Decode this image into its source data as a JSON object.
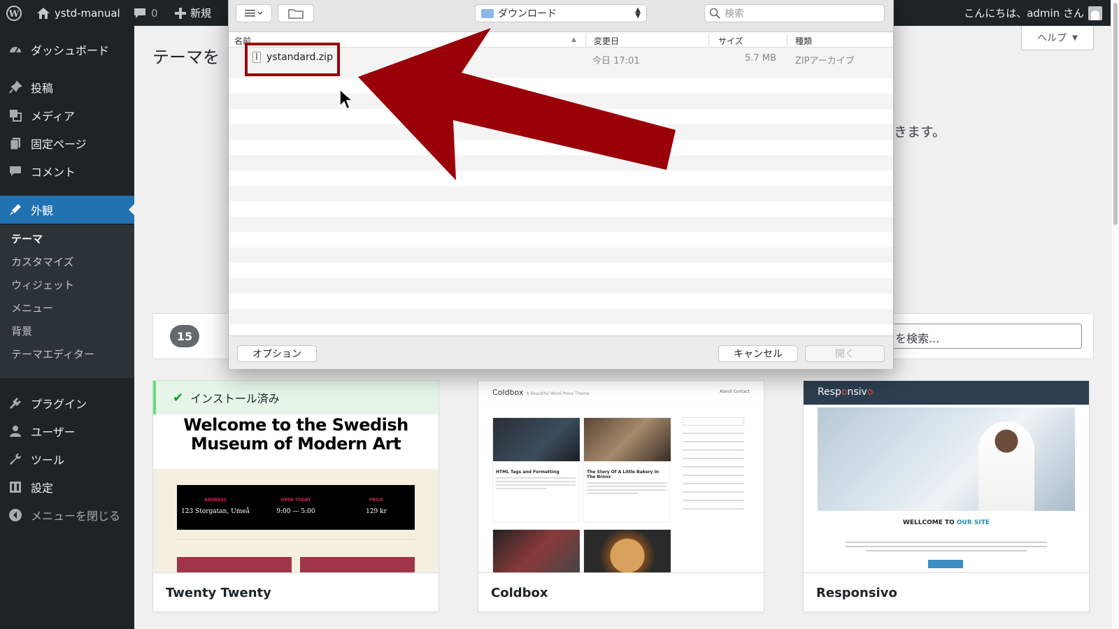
{
  "adminbar": {
    "site_name": "ystd-manual",
    "comment_count": "0",
    "new_label": "新規",
    "greeting": "こんにちは、admin さん"
  },
  "sidebar": {
    "items": [
      {
        "label": "ダッシュボード",
        "icon": "dashboard-icon"
      },
      {
        "label": "投稿",
        "icon": "pin-icon"
      },
      {
        "label": "メディア",
        "icon": "media-icon"
      },
      {
        "label": "固定ページ",
        "icon": "page-icon"
      },
      {
        "label": "コメント",
        "icon": "comment-icon"
      },
      {
        "label": "外観",
        "icon": "appearance-icon"
      },
      {
        "label": "プラグイン",
        "icon": "plugin-icon"
      },
      {
        "label": "ユーザー",
        "icon": "user-icon"
      },
      {
        "label": "ツール",
        "icon": "wrench-icon"
      },
      {
        "label": "設定",
        "icon": "settings-icon"
      }
    ],
    "submenu": [
      "テーマ",
      "カスタマイズ",
      "ウィジェット",
      "メニュー",
      "背景",
      "テーマエディター"
    ],
    "collapse_label": "メニューを閉じる"
  },
  "content": {
    "page_title": "テーマを",
    "help_label": "ヘルプ",
    "upload_text_tail": "きます。",
    "theme_count": "15",
    "search_placeholder": "を検索..."
  },
  "themes": [
    {
      "name": "Twenty Twenty",
      "installed_label": "インストール済み",
      "preview_title": "Welcome to the Swedish Museum of Modern Art",
      "preview_cols": [
        {
          "k": "ADDRESS",
          "v": "123 Storgatan, Umeå"
        },
        {
          "k": "OPEN TODAY",
          "v": "9:00 — 5:00"
        },
        {
          "k": "PRICE",
          "v": "129 kr"
        }
      ]
    },
    {
      "name": "Coldbox",
      "preview_brand": "Coldbox",
      "preview_tagline": "A Beautiful Word Press Theme",
      "preview_nav": "About  Contact",
      "preview_posts": [
        "HTML Tags and Formatting",
        "The Story Of A Little Bakery In The Bronx"
      ]
    },
    {
      "name": "Responsivo",
      "preview_brand_a": "Resp",
      "preview_brand_b": "o",
      "preview_brand_c": "nsiv",
      "preview_brand_d": "o",
      "preview_heading_a": "WELLCOME TO ",
      "preview_heading_b": "OUR SITE"
    }
  ],
  "dialog": {
    "location": "ダウンロード",
    "search_placeholder": "検索",
    "columns": {
      "name": "名前",
      "modified": "変更日",
      "size": "サイズ",
      "kind": "種類"
    },
    "file": {
      "name": "ystandard.zip",
      "modified": "今日 17:01",
      "size": "5.7 MB",
      "kind": "ZIPアーカイブ"
    },
    "buttons": {
      "options": "オプション",
      "cancel": "キャンセル",
      "open": "開く"
    }
  },
  "colors": {
    "annotation": "#9a0007",
    "wp_blue": "#2271b1",
    "admin_dark": "#1d2327"
  }
}
